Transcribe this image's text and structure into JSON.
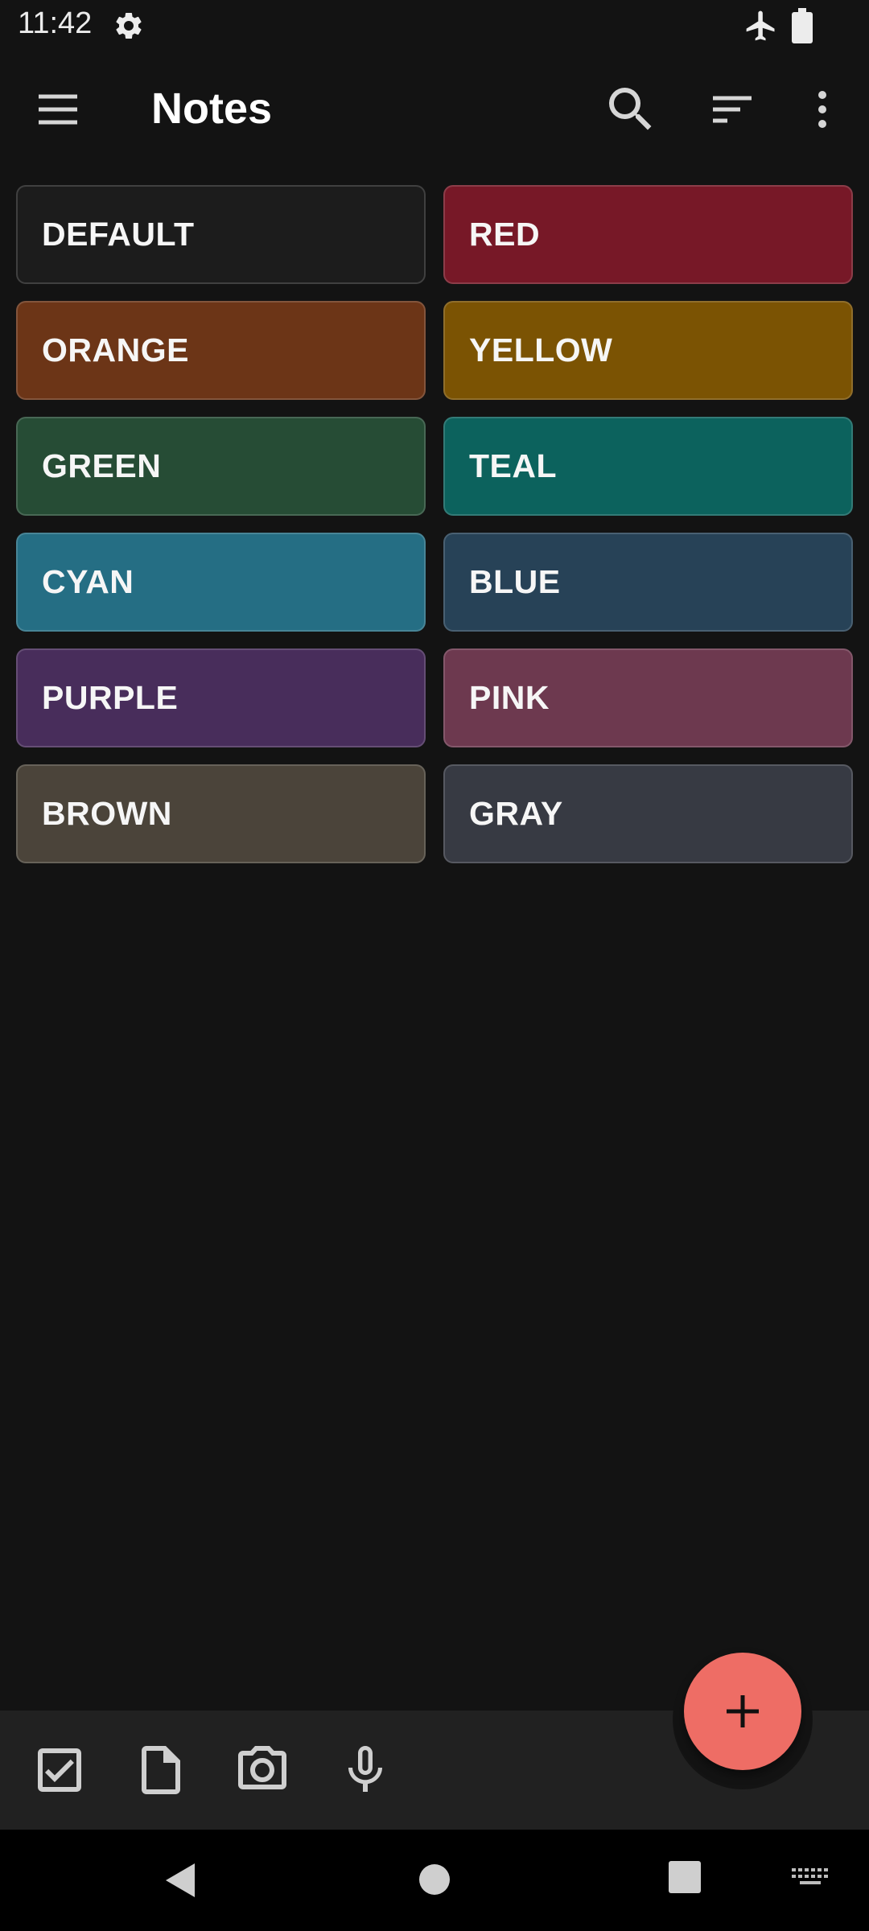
{
  "status_bar": {
    "time": "11:42",
    "icons": [
      "gear-icon",
      "airplane-mode-icon",
      "battery-icon"
    ]
  },
  "app_bar": {
    "title": "Notes",
    "actions": [
      "menu-icon",
      "search-icon",
      "sort-icon",
      "more-vert-icon"
    ]
  },
  "notes": [
    {
      "label": "DEFAULT",
      "color": "#1c1c1c"
    },
    {
      "label": "RED",
      "color": "#771827"
    },
    {
      "label": "ORANGE",
      "color": "#6c3517"
    },
    {
      "label": "YELLOW",
      "color": "#7b5303"
    },
    {
      "label": "GREEN",
      "color": "#264c35"
    },
    {
      "label": "TEAL",
      "color": "#0c625d"
    },
    {
      "label": "CYAN",
      "color": "#256e84"
    },
    {
      "label": "BLUE",
      "color": "#274257"
    },
    {
      "label": "PURPLE",
      "color": "#482d5b"
    },
    {
      "label": "PINK",
      "color": "#6d394f"
    },
    {
      "label": "BROWN",
      "color": "#4b443a"
    },
    {
      "label": "GRAY",
      "color": "#373a43"
    }
  ],
  "bottom_toolbar": {
    "tools": [
      "checkbox-icon",
      "document-icon",
      "camera-icon",
      "microphone-icon"
    ],
    "fab_icon": "plus-icon",
    "fab_color": "#ee6d65"
  },
  "nav_bar": {
    "buttons": [
      "back-icon",
      "home-icon",
      "recents-icon",
      "keyboard-icon"
    ]
  }
}
